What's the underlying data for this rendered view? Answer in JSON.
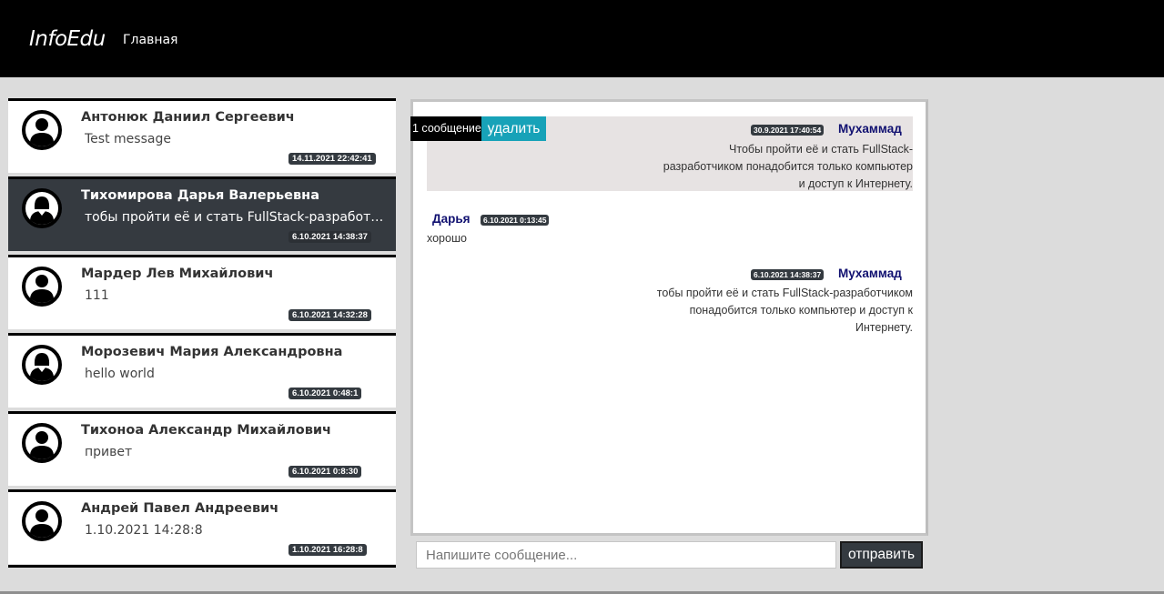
{
  "navbar": {
    "brand": "InfoEdu",
    "home_link": "Главная"
  },
  "contacts": [
    {
      "name": "Антонюк Даниил Сергеевич",
      "last_message": "Test message",
      "date": "14.11.2021 22:42:41",
      "avatar": "male-avatar-icon",
      "active": false
    },
    {
      "name": "Тихомирова Дарья Валерьевна",
      "last_message": "тобы пройти её и стать FullStack-разработчик...",
      "date": "6.10.2021 14:38:37",
      "avatar": "female-avatar-icon",
      "active": true
    },
    {
      "name": "Мардер Лев Михайлович",
      "last_message": "111",
      "date": "6.10.2021 14:32:28",
      "avatar": "male-avatar-icon",
      "active": false
    },
    {
      "name": "Морозевич Мария Александровна",
      "last_message": "hello world",
      "date": "6.10.2021 0:48:1",
      "avatar": "female-avatar-icon",
      "active": false
    },
    {
      "name": "Тихоноа Александр Михайлович",
      "last_message": "привет",
      "date": "6.10.2021 0:8:30",
      "avatar": "male-avatar-icon",
      "active": false
    },
    {
      "name": "Андрей Павел Андреевич",
      "last_message": "1.10.2021 14:28:8",
      "date": "1.10.2021 16:28:8",
      "avatar": "male-avatar-icon",
      "active": false
    }
  ],
  "chat": {
    "selection_count": "1 сообщение",
    "delete_label": "удалить",
    "messages": [
      {
        "author": "Мухаммад",
        "date": "30.9.2021 17:40:54",
        "lines": [
          "Чтобы пройти её и стать FullStack-",
          "разработчиком понадобится только компьютер",
          "и доступ к Интернету."
        ],
        "align": "right",
        "selected": true
      },
      {
        "author": "Дарья",
        "date": "6.10.2021 0:13:45",
        "lines": [
          "хорошо"
        ],
        "align": "left",
        "selected": false
      },
      {
        "author": "Мухаммад",
        "date": "6.10.2021 14:38:37",
        "lines": [
          "тобы пройти её и стать FullStack-разработчиком",
          "понадобится только компьютер и доступ к",
          "Интернету."
        ],
        "align": "right",
        "selected": false
      }
    ]
  },
  "composer": {
    "placeholder": "Напишите сообщение...",
    "send_label": "отправить"
  }
}
